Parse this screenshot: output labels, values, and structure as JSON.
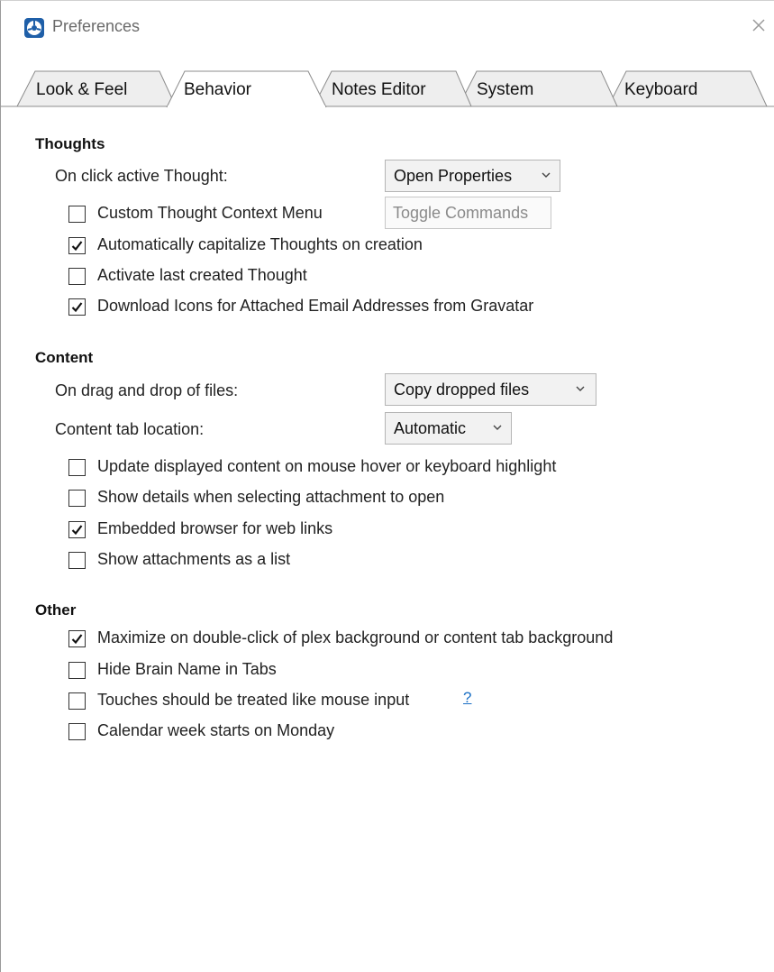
{
  "window": {
    "title": "Preferences"
  },
  "tabs": [
    {
      "label": "Look & Feel",
      "active": false
    },
    {
      "label": "Behavior",
      "active": true
    },
    {
      "label": "Notes Editor",
      "active": false
    },
    {
      "label": "System",
      "active": false
    },
    {
      "label": "Keyboard",
      "active": false
    }
  ],
  "thoughts": {
    "heading": "Thoughts",
    "on_click_label": "On click active Thought:",
    "on_click_value": "Open Properties",
    "custom_menu": {
      "label": "Custom Thought Context Menu",
      "checked": false
    },
    "toggle_commands_label": "Toggle Commands",
    "auto_capitalize": {
      "label": "Automatically capitalize Thoughts on creation",
      "checked": true
    },
    "activate_last": {
      "label": "Activate last created Thought",
      "checked": false
    },
    "download_icons": {
      "label": "Download Icons for Attached Email Addresses from Gravatar",
      "checked": true
    }
  },
  "content": {
    "heading": "Content",
    "drag_drop_label": "On drag and drop of files:",
    "drag_drop_value": "Copy dropped files",
    "tab_location_label": "Content tab location:",
    "tab_location_value": "Automatic",
    "update_on_hover": {
      "label": "Update displayed content on mouse hover or keyboard highlight",
      "checked": false
    },
    "show_details": {
      "label": "Show details when selecting attachment to open",
      "checked": false
    },
    "embedded_browser": {
      "label": "Embedded browser for web links",
      "checked": true
    },
    "attachments_list": {
      "label": "Show attachments as a list",
      "checked": false
    }
  },
  "other": {
    "heading": "Other",
    "maximize": {
      "label": "Maximize on double-click of plex background or content tab background",
      "checked": true
    },
    "hide_brain_name": {
      "label": "Hide Brain Name in Tabs",
      "checked": false
    },
    "touches_mouse": {
      "label": "Touches should be treated like mouse input",
      "checked": false
    },
    "help_link": "?",
    "week_monday": {
      "label": "Calendar week starts on Monday",
      "checked": false
    }
  },
  "colors": {
    "accent": "#1a6fc4",
    "tab_bg": "#efefef",
    "border": "#8c8c8c"
  },
  "icons": {
    "app": "brain-app-icon",
    "close": "close-icon",
    "check": "checkmark-icon",
    "chevron": "chevron-down-icon"
  }
}
